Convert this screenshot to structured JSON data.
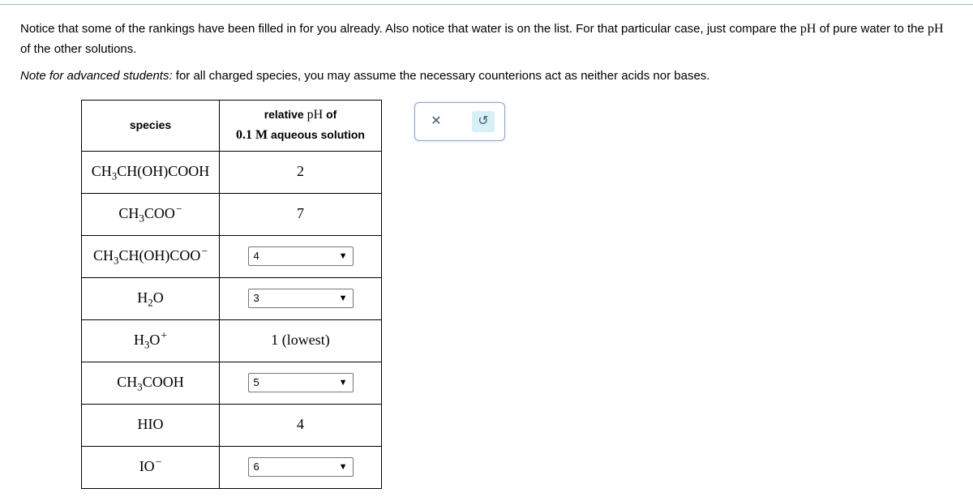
{
  "intro": {
    "p1a": "Notice that some of the rankings have been filled in for you already. Also notice that water is on the list. For that particular case, just compare the ",
    "pH": "pH",
    "p1b": " of pure water to the ",
    "p1c": " of the other solutions.",
    "note_label": "Note for advanced students:",
    "note_rest": " for all charged species, you may assume the necessary counterions act as neither acids nor bases."
  },
  "headers": {
    "species": "species",
    "rel_a": "relative ",
    "rel_b": " of",
    "rel_c": "0.1 M",
    "rel_d": " aqueous solution"
  },
  "rows": {
    "r1": {
      "static": "2"
    },
    "r2": {
      "static": "7"
    },
    "r3": {
      "select": "4"
    },
    "r4": {
      "select": "3"
    },
    "r5": {
      "static": "1 (lowest)"
    },
    "r6": {
      "select": "5"
    },
    "r7": {
      "static": "4"
    },
    "r8": {
      "select": "6"
    }
  },
  "tools": {
    "close": "✕",
    "reset": "↺"
  }
}
